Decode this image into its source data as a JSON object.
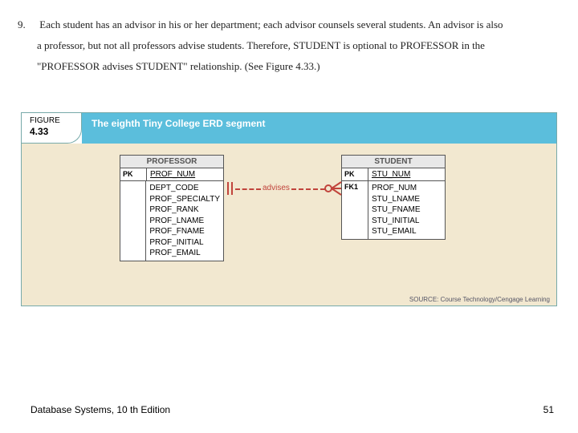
{
  "question": {
    "number": "9.",
    "text_l1": "Each student has an advisor in his or her department; each advisor counsels several students. An advisor is also",
    "text_l2": "a professor, but not all professors advise students. Therefore, STUDENT is optional to PROFESSOR in the",
    "text_l3": "\"PROFESSOR advises STUDENT\" relationship. (See Figure 4.33.)"
  },
  "figure": {
    "label_top": "FIGURE",
    "label_num": "4.33",
    "title": "The eighth Tiny College ERD segment",
    "source": "SOURCE: Course Technology/Cengage Learning"
  },
  "entities": {
    "professor": {
      "name": "PROFESSOR",
      "pk_label": "PK",
      "pk_field": "PROF_NUM",
      "attrs": [
        "DEPT_CODE",
        "PROF_SPECIALTY",
        "PROF_RANK",
        "PROF_LNAME",
        "PROF_FNAME",
        "PROF_INITIAL",
        "PROF_EMAIL"
      ]
    },
    "student": {
      "name": "STUDENT",
      "pk_label": "PK",
      "pk_field": "STU_NUM",
      "fk_label": "FK1",
      "attrs": [
        "PROF_NUM",
        "STU_LNAME",
        "STU_FNAME",
        "STU_INITIAL",
        "STU_EMAIL"
      ]
    }
  },
  "relationship": {
    "label": "advises"
  },
  "footer": {
    "left": "Database Systems, 10 th Edition",
    "right": "51"
  }
}
